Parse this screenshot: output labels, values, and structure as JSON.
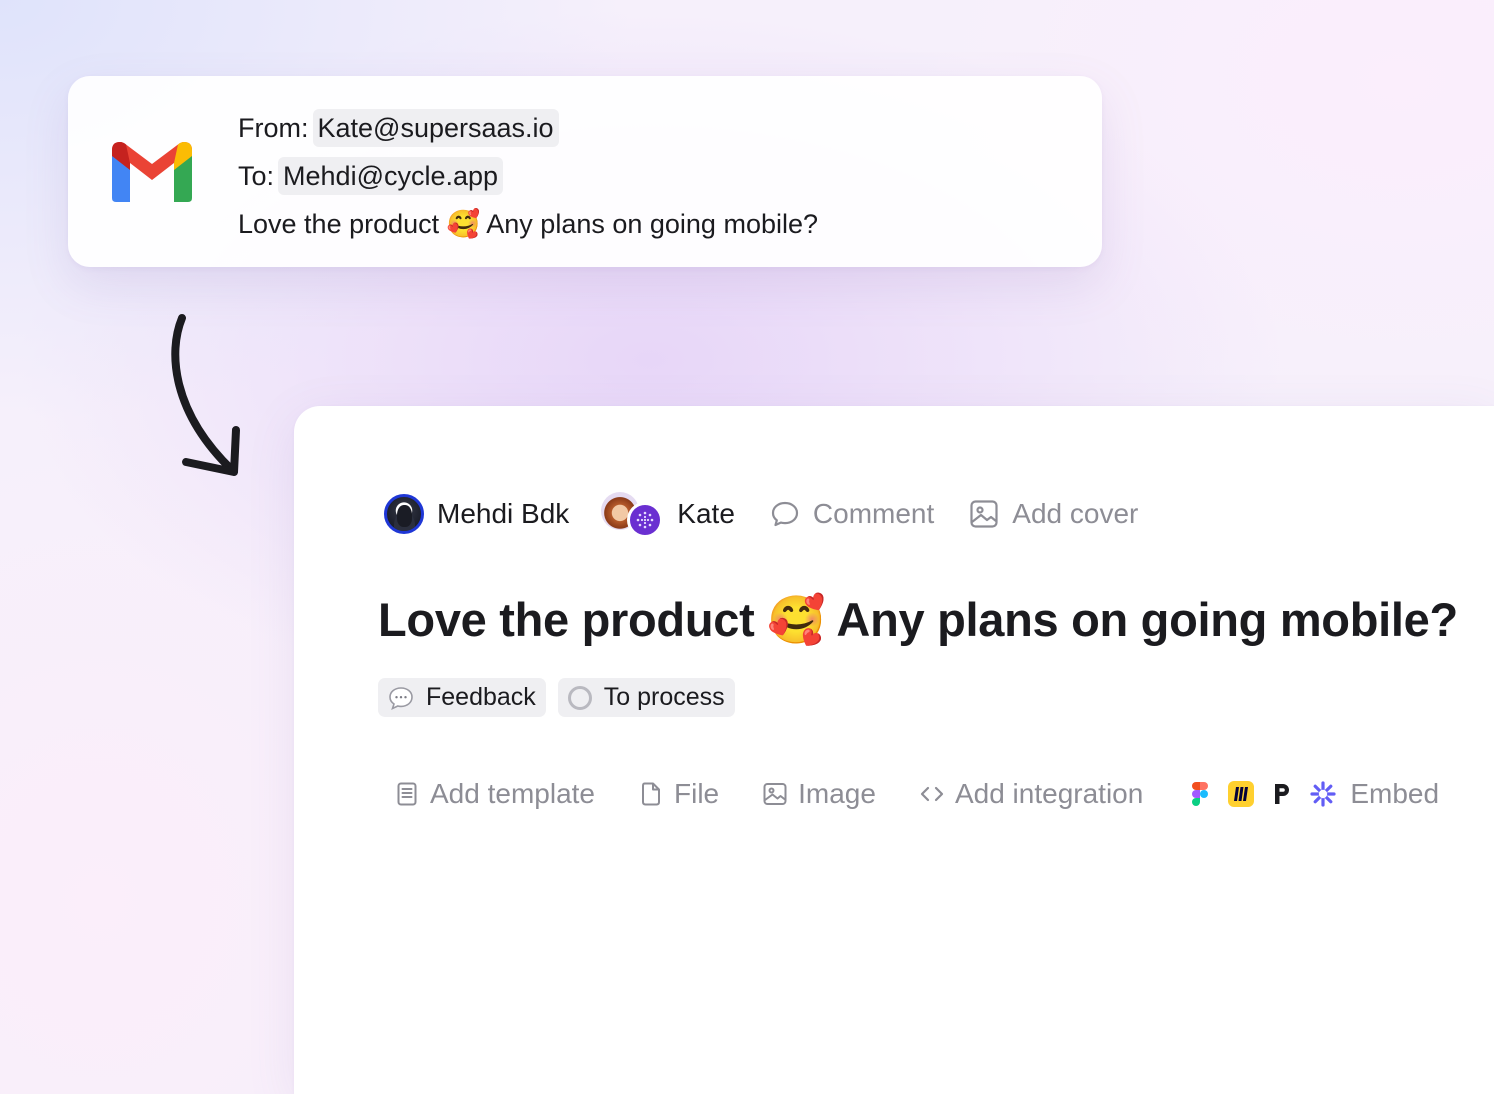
{
  "email": {
    "logo": "gmail-icon",
    "from_label": "From:",
    "from_address": "Kate@supersaas.io",
    "to_label": "To:",
    "to_address": "Mehdi@cycle.app",
    "message": "Love the product 🥰 Any plans on going mobile?"
  },
  "doc": {
    "meta": {
      "assignee": "Mehdi Bdk",
      "customer": "Kate",
      "comment_label": "Comment",
      "cover_label": "Add cover"
    },
    "title": "Love the product 🥰 Any plans on going mobile?",
    "tags": {
      "type_label": "Feedback",
      "status_label": "To process"
    },
    "toolbar": {
      "template_label": "Add template",
      "file_label": "File",
      "image_label": "Image",
      "integration_label": "Add integration",
      "embed_label": "Embed",
      "integration_icons": [
        "figma-icon",
        "miro-icon",
        "pitch-icon",
        "loom-icon"
      ]
    }
  },
  "colors": {
    "accent_blue": "#1f37d6",
    "cycle_purple": "#6a2fd1",
    "muted_text": "#8d8d95",
    "chip_bg": "#efeff2"
  }
}
